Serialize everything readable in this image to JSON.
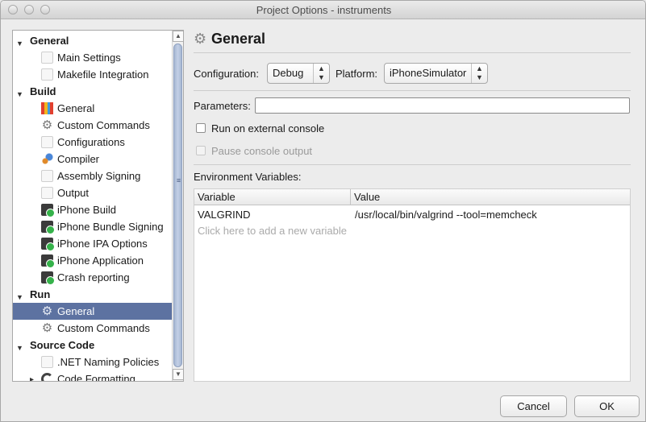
{
  "window": {
    "title": "Project Options - instruments"
  },
  "sidebar": {
    "groups": [
      {
        "label": "General",
        "items": [
          {
            "label": "Main Settings",
            "icon": "blank-icon"
          },
          {
            "label": "Makefile Integration",
            "icon": "blank-icon"
          }
        ]
      },
      {
        "label": "Build",
        "items": [
          {
            "label": "General",
            "icon": "build-bricks-icon"
          },
          {
            "label": "Custom Commands",
            "icon": "gear-icon"
          },
          {
            "label": "Configurations",
            "icon": "blank-icon"
          },
          {
            "label": "Compiler",
            "icon": "compiler-icon"
          },
          {
            "label": "Assembly Signing",
            "icon": "blank-icon"
          },
          {
            "label": "Output",
            "icon": "blank-icon"
          },
          {
            "label": "iPhone Build",
            "icon": "iphone-icon"
          },
          {
            "label": "iPhone Bundle Signing",
            "icon": "iphone-icon"
          },
          {
            "label": "iPhone IPA Options",
            "icon": "iphone-icon"
          },
          {
            "label": "iPhone Application",
            "icon": "iphone-icon"
          },
          {
            "label": "Crash reporting",
            "icon": "iphone-icon"
          }
        ]
      },
      {
        "label": "Run",
        "items": [
          {
            "label": "General",
            "icon": "gears-icon",
            "selected": true
          },
          {
            "label": "Custom Commands",
            "icon": "gear-icon"
          }
        ]
      },
      {
        "label": "Source Code",
        "items": [
          {
            "label": ".NET Naming Policies",
            "icon": "blank-icon"
          },
          {
            "label": "Code Formatting",
            "icon": "code-formatting-icon",
            "collapsed": true
          }
        ]
      }
    ]
  },
  "main": {
    "title": "General",
    "configuration_label": "Configuration:",
    "configuration_value": "Debug",
    "platform_label": "Platform:",
    "platform_value": "iPhoneSimulator",
    "parameters_label": "Parameters:",
    "parameters_value": "",
    "run_external_label": "Run on external console",
    "run_external_checked": false,
    "pause_console_label": "Pause console output",
    "pause_console_enabled": false,
    "env_label": "Environment Variables:",
    "env_table": {
      "columns": [
        "Variable",
        "Value"
      ],
      "rows": [
        {
          "variable": "VALGRIND",
          "value": "/usr/local/bin/valgrind --tool=memcheck"
        }
      ],
      "add_hint": "Click here to add a new variable"
    }
  },
  "footer": {
    "cancel_label": "Cancel",
    "ok_label": "OK"
  },
  "colors": {
    "selection": "#5d72a1",
    "scroll_thumb": "#b3c1db",
    "window_bg": "#ececec"
  }
}
